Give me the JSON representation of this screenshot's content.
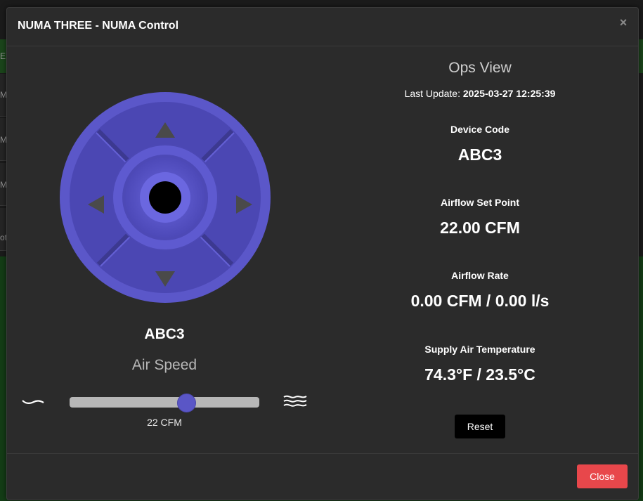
{
  "modal": {
    "title": "NUMA THREE - NUMA Control",
    "close_icon": "×",
    "close_label": "Close"
  },
  "background": {
    "row_letters": [
      "E",
      "M",
      "M",
      "M",
      "ot"
    ]
  },
  "joystick": {
    "device_name": "ABC3",
    "air_speed_label": "Air Speed",
    "accent_color": "#5b57c9",
    "slider": {
      "value_label": "22 CFM",
      "fraction": 0.61
    },
    "low_icon": "wave-low-icon",
    "high_icon": "wave-high-icon"
  },
  "ops": {
    "title": "Ops View",
    "last_update_label": "Last Update:",
    "last_update_value": "2025-03-27 12:25:39",
    "fields": [
      {
        "label": "Device Code",
        "value": "ABC3"
      },
      {
        "label": "Airflow Set Point",
        "value": "22.00 CFM"
      },
      {
        "label": "Airflow Rate",
        "value": "0.00 CFM / 0.00 l/s"
      },
      {
        "label": "Supply Air Temperature",
        "value": "74.3°F / 23.5°C"
      }
    ],
    "reset_label": "Reset"
  },
  "colors": {
    "close_button": "#e8474b",
    "modal_bg": "#2b2b2b"
  }
}
